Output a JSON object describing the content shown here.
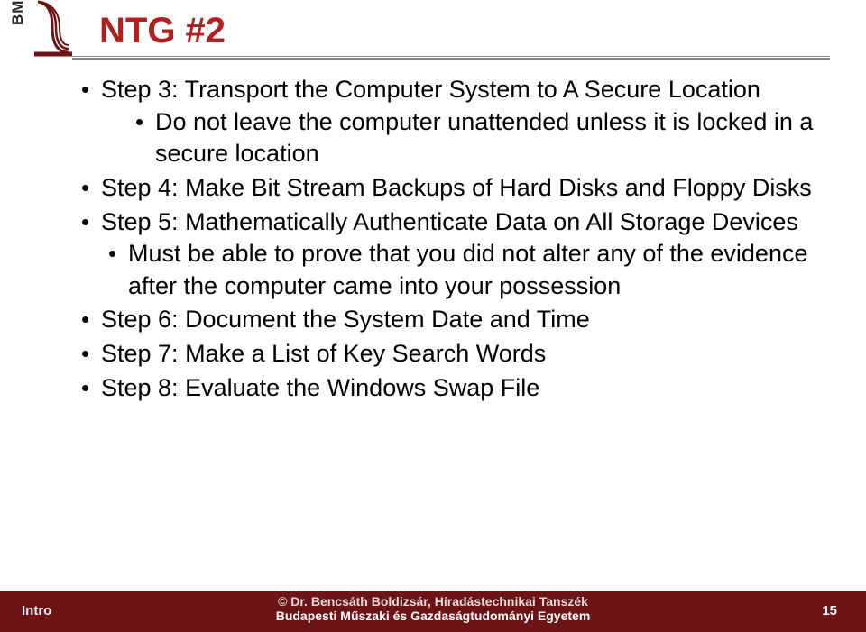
{
  "sidebar": {
    "bme": "BME"
  },
  "title": "NTG #2",
  "bullets": {
    "b1": "Step 3: Transport the Computer System to A Secure Location",
    "b1_1": "Do not leave the computer unattended unless it is locked in a secure location",
    "b2": "Step 4: Make Bit Stream Backups of Hard Disks and Floppy Disks",
    "b3": "Step 5: Mathematically Authenticate Data on All Storage Devices",
    "b3_1": "Must be able to prove that you did not alter any of the evidence after the computer came into your possession",
    "b4": "Step 6: Document the System Date and Time",
    "b5": "Step 7: Make a List of Key Search Words",
    "b6": "Step 8: Evaluate the Windows Swap File"
  },
  "footer": {
    "left": "Intro",
    "line1": "© Dr. Bencsáth Boldizsár, Híradástechnikai Tanszék",
    "line2": "Budapesti Műszaki és Gazdaságtudományi Egyetem",
    "page": "15"
  }
}
